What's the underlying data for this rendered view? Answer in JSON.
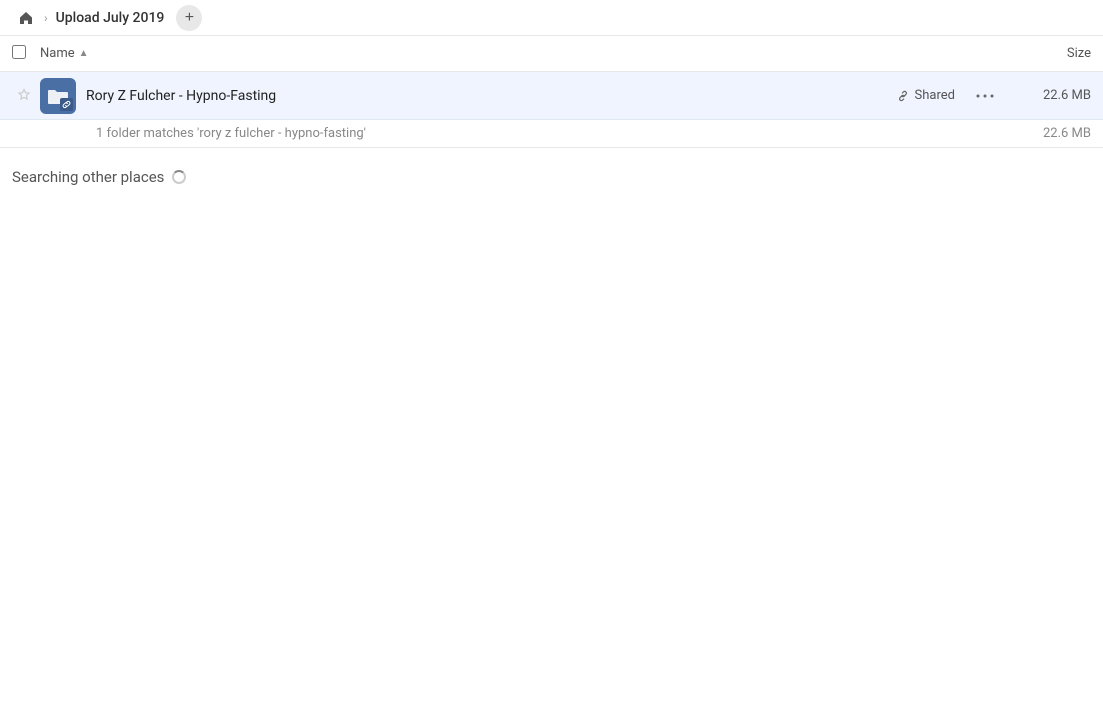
{
  "header": {
    "home_title": "Home",
    "breadcrumb_title": "Upload July 2019",
    "add_button_label": "+"
  },
  "columns": {
    "name_label": "Name",
    "size_label": "Size"
  },
  "file_row": {
    "name": "Rory Z Fulcher - Hypno-Fasting",
    "shared_label": "Shared",
    "size": "22.6 MB",
    "more_label": "..."
  },
  "match_note": {
    "text": "1 folder matches 'rory z fulcher - hypno-fasting'",
    "size": "22.6 MB"
  },
  "searching": {
    "text": "Searching other places"
  },
  "icons": {
    "home": "⌂",
    "star": "☆",
    "folder": "📁",
    "link": "🔗",
    "more": "•••"
  }
}
